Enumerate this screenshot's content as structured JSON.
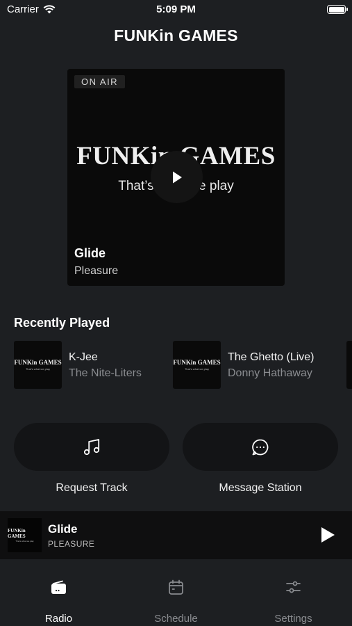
{
  "status": {
    "carrier": "Carrier",
    "time": "5:09 PM"
  },
  "app": {
    "title": "FUNKin GAMES"
  },
  "now_playing": {
    "badge": "ON AIR",
    "cover_logo": "FUNKin GAMES",
    "cover_tagline": "That’s what we play",
    "track": "Glide",
    "artist": "Pleasure"
  },
  "recently_played": {
    "title": "Recently Played",
    "thumb_logo": "FUNKin GAMES",
    "thumb_tagline": "That's what we play",
    "items": [
      {
        "track": "K-Jee",
        "artist": "The Nite-Liters"
      },
      {
        "track": "The Ghetto (Live)",
        "artist": "Donny Hathaway"
      }
    ]
  },
  "actions": {
    "request_label": "Request Track",
    "message_label": "Message Station"
  },
  "mini_player": {
    "track": "Glide",
    "artist": "PLEASURE",
    "thumb_logo": "FUNKin GAMES",
    "thumb_tagline": "That's what we play"
  },
  "tabs": [
    {
      "label": "Radio",
      "icon": "radio-icon",
      "active": true
    },
    {
      "label": "Schedule",
      "icon": "calendar-icon",
      "active": false
    },
    {
      "label": "Settings",
      "icon": "sliders-icon",
      "active": false
    }
  ],
  "colors": {
    "background": "#1d1f22",
    "accent": "#e07b1a",
    "inactive_tab": "#8a8c90"
  }
}
